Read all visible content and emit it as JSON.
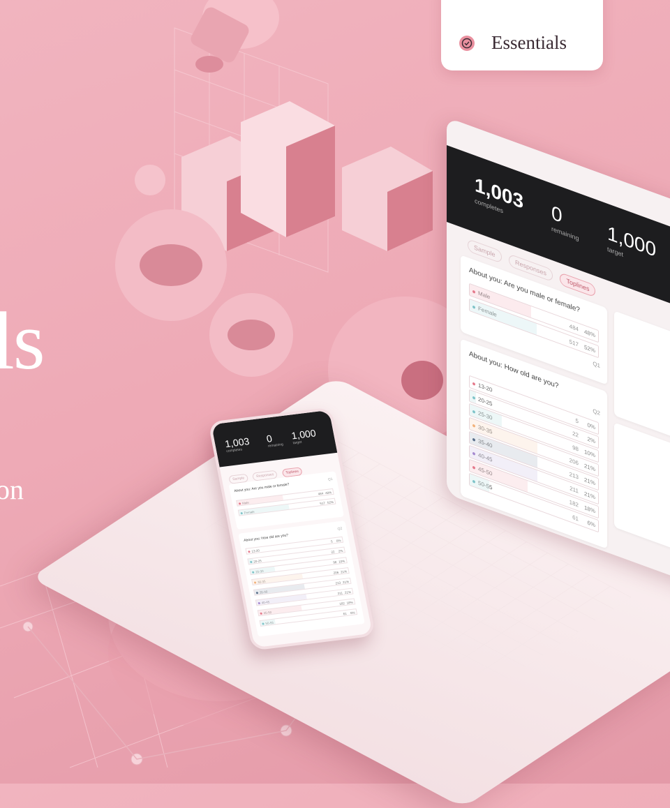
{
  "hero": {
    "title": "ls",
    "subtitle": "on"
  },
  "badge": {
    "label": "Essentials",
    "icon": "check-circle-icon"
  },
  "colors": {
    "background": "#eeaab6",
    "accent": "#e9909f",
    "header_dark": "#1d1d1f"
  },
  "dashboard": {
    "stats": [
      {
        "value": "1,003",
        "label": "completes"
      },
      {
        "value": "0",
        "label": "remaining"
      },
      {
        "value": "1,000",
        "label": "target"
      }
    ],
    "tabs": [
      "Sample",
      "Responses",
      "Toplines"
    ],
    "active_tab": "Toplines",
    "questions": [
      {
        "number": "Q1",
        "text": "About you: Are you male or female?",
        "options": [
          {
            "label": "Male",
            "count": "484",
            "percent": "48%",
            "color": "#e57a8c"
          },
          {
            "label": "Female",
            "count": "517",
            "percent": "52%",
            "color": "#7fc4c9"
          }
        ]
      },
      {
        "number": "Q2",
        "text": "About you: How old are you?",
        "options": [
          {
            "label": "13-20",
            "count": "5",
            "percent": "0%",
            "color": "#e57a8c"
          },
          {
            "label": "20-25",
            "count": "22",
            "percent": "2%",
            "color": "#7fc4c9"
          },
          {
            "label": "25-30",
            "count": "98",
            "percent": "10%",
            "color": "#7fc4c9"
          },
          {
            "label": "30-35",
            "count": "206",
            "percent": "21%",
            "color": "#f2b27a"
          },
          {
            "label": "35-40",
            "count": "213",
            "percent": "21%",
            "color": "#5a6f8a"
          },
          {
            "label": "40-45",
            "count": "211",
            "percent": "21%",
            "color": "#a68ad0"
          },
          {
            "label": "45-50",
            "count": "182",
            "percent": "18%",
            "color": "#e57a8c"
          },
          {
            "label": "50-55",
            "count": "61",
            "percent": "6%",
            "color": "#7fc4c9"
          }
        ]
      }
    ]
  }
}
